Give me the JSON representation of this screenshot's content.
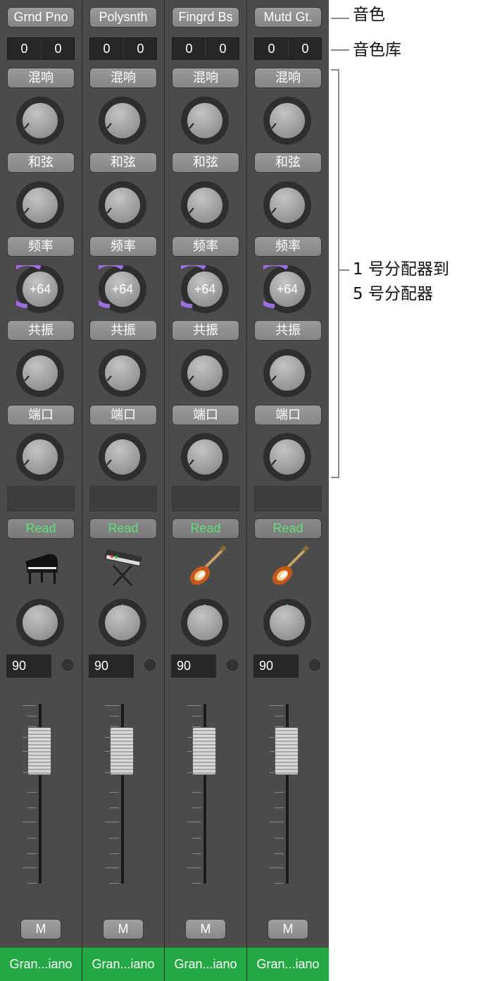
{
  "strips": [
    {
      "patch": "Grnd Pno",
      "bank": [
        "0",
        "0"
      ],
      "smart_controls": [
        {
          "label": "混响",
          "value": ""
        },
        {
          "label": "和弦",
          "value": ""
        },
        {
          "label": "频率",
          "value": "+64"
        },
        {
          "label": "共振",
          "value": ""
        },
        {
          "label": "端口",
          "value": ""
        }
      ],
      "automation": "Read",
      "instrument_icon": "grand-piano-icon",
      "volume": "90",
      "mute": "M",
      "track_name": "Gran...iano"
    },
    {
      "patch": "Polysnth",
      "bank": [
        "0",
        "0"
      ],
      "smart_controls": [
        {
          "label": "混响",
          "value": ""
        },
        {
          "label": "和弦",
          "value": ""
        },
        {
          "label": "频率",
          "value": "+64"
        },
        {
          "label": "共振",
          "value": ""
        },
        {
          "label": "端口",
          "value": ""
        }
      ],
      "automation": "Read",
      "instrument_icon": "synthesizer-keyboard-icon",
      "volume": "90",
      "mute": "M",
      "track_name": "Gran...iano"
    },
    {
      "patch": "Fingrd Bs",
      "bank": [
        "0",
        "0"
      ],
      "smart_controls": [
        {
          "label": "混响",
          "value": ""
        },
        {
          "label": "和弦",
          "value": ""
        },
        {
          "label": "频率",
          "value": "+64"
        },
        {
          "label": "共振",
          "value": ""
        },
        {
          "label": "端口",
          "value": ""
        }
      ],
      "automation": "Read",
      "instrument_icon": "electric-guitar-icon",
      "volume": "90",
      "mute": "M",
      "track_name": "Gran...iano"
    },
    {
      "patch": "Mutd Gt.",
      "bank": [
        "0",
        "0"
      ],
      "smart_controls": [
        {
          "label": "混响",
          "value": ""
        },
        {
          "label": "和弦",
          "value": ""
        },
        {
          "label": "频率",
          "value": "+64"
        },
        {
          "label": "共振",
          "value": ""
        },
        {
          "label": "端口",
          "value": ""
        }
      ],
      "automation": "Read",
      "instrument_icon": "electric-guitar-icon",
      "volume": "90",
      "mute": "M",
      "track_name": "Gran...iano"
    }
  ],
  "callouts": {
    "patch": "音色",
    "bank": "音色库",
    "controls_line1": "1 号分配器到",
    "controls_line2": "5 号分配器"
  },
  "colors": {
    "strip_bg": "#4b4b4b",
    "automation_read": "#5fe07a",
    "track_name_bg": "#23a843",
    "freq_arc": "#9b6fe0"
  }
}
